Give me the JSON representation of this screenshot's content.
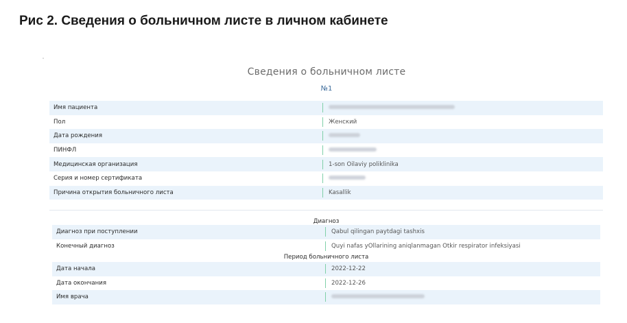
{
  "caption": "Рис 2. Сведения о больничном листе в личном кабинете",
  "card": {
    "title": "Сведения о больничном листе",
    "number": "№1"
  },
  "patient_rows": [
    {
      "label": "Имя пациента",
      "value": "",
      "redacted": true
    },
    {
      "label": "Пол",
      "value": "Женский",
      "redacted": false
    },
    {
      "label": "Дата рождения",
      "value": "",
      "redacted": true
    },
    {
      "label": "ПИНФЛ",
      "value": "",
      "redacted": true
    },
    {
      "label": "Медицинская организация",
      "value": "1-son Oilaviy poliklinika",
      "redacted": false
    },
    {
      "label": "Серия и номер сертификата",
      "value": "",
      "redacted": true
    },
    {
      "label": "Причина открытия больничного листа",
      "value": "Kasallik",
      "redacted": false
    }
  ],
  "diagnosis": {
    "heading": "Диагноз",
    "rows": [
      {
        "label": "Диагноз при поступлении",
        "value": "Qabul qilingan paytdagi tashxis"
      },
      {
        "label": "Конечный диагноз",
        "value": "Quyi nafas yOllarining aniqlanmagan Otkir respirator infeksiyasi"
      }
    ]
  },
  "period": {
    "heading": "Период больничного листа",
    "rows": [
      {
        "label": "Дата начала",
        "value": "2022-12-22",
        "redacted": false
      },
      {
        "label": "Дата окончания",
        "value": "2022-12-26",
        "redacted": false
      },
      {
        "label": "Имя врача",
        "value": "",
        "redacted": true
      }
    ]
  },
  "colors": {
    "row_shade": "#eaf3fb",
    "divider": "#7fd0a8",
    "number_text": "#3b6a9a"
  }
}
